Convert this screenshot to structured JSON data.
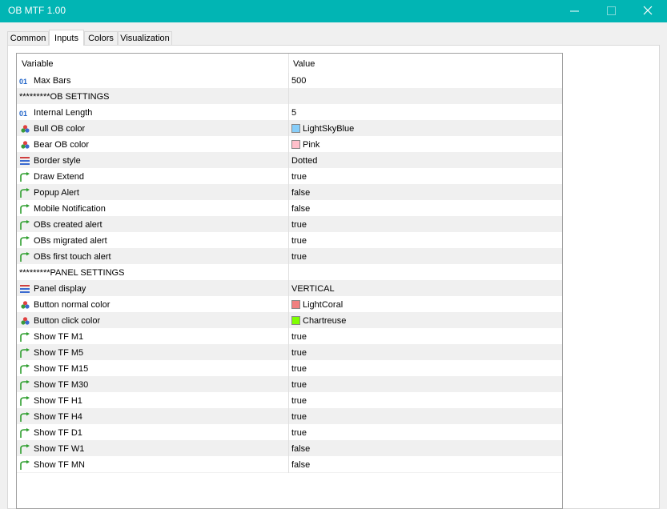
{
  "window": {
    "title": "OB MTF 1.00"
  },
  "tabs": [
    {
      "label": "Common",
      "active": false
    },
    {
      "label": "Inputs",
      "active": true
    },
    {
      "label": "Colors",
      "active": false
    },
    {
      "label": "Visualization",
      "active": false
    }
  ],
  "table": {
    "headers": {
      "variable": "Variable",
      "value": "Value"
    },
    "rows": [
      {
        "icon": "int-icon",
        "name": "Max Bars",
        "value": "500"
      },
      {
        "icon": "",
        "name": "*********OB SETTINGS",
        "value": ""
      },
      {
        "icon": "int-icon",
        "name": "Internal Length",
        "value": "5"
      },
      {
        "icon": "color-icon",
        "name": "Bull OB color",
        "value": "LightSkyBlue",
        "swatch": "#87cefa"
      },
      {
        "icon": "color-icon",
        "name": "Bear OB color",
        "value": "Pink",
        "swatch": "#ffc0cb"
      },
      {
        "icon": "enum-icon",
        "name": "Border style",
        "value": "Dotted"
      },
      {
        "icon": "bool-icon",
        "name": "Draw Extend",
        "value": "true"
      },
      {
        "icon": "bool-icon",
        "name": "Popup Alert",
        "value": "false"
      },
      {
        "icon": "bool-icon",
        "name": "Mobile Notification",
        "value": "false"
      },
      {
        "icon": "bool-icon",
        "name": "OBs created alert",
        "value": "true"
      },
      {
        "icon": "bool-icon",
        "name": "OBs migrated alert",
        "value": "true"
      },
      {
        "icon": "bool-icon",
        "name": "OBs first touch alert",
        "value": "true"
      },
      {
        "icon": "",
        "name": "*********PANEL SETTINGS",
        "value": ""
      },
      {
        "icon": "enum-icon",
        "name": "Panel display",
        "value": "VERTICAL"
      },
      {
        "icon": "color-icon",
        "name": "Button normal color",
        "value": "LightCoral",
        "swatch": "#f08080"
      },
      {
        "icon": "color-icon",
        "name": "Button click color",
        "value": "Chartreuse",
        "swatch": "#7fff00"
      },
      {
        "icon": "bool-icon",
        "name": "Show TF M1",
        "value": "true"
      },
      {
        "icon": "bool-icon",
        "name": "Show TF M5",
        "value": "true"
      },
      {
        "icon": "bool-icon",
        "name": "Show TF M15",
        "value": "true"
      },
      {
        "icon": "bool-icon",
        "name": "Show TF M30",
        "value": "true"
      },
      {
        "icon": "bool-icon",
        "name": "Show TF H1",
        "value": "true"
      },
      {
        "icon": "bool-icon",
        "name": "Show TF H4",
        "value": "true"
      },
      {
        "icon": "bool-icon",
        "name": "Show TF D1",
        "value": "true"
      },
      {
        "icon": "bool-icon",
        "name": "Show TF W1",
        "value": "false"
      },
      {
        "icon": "bool-icon",
        "name": "Show TF MN",
        "value": "false"
      }
    ]
  },
  "colors": {
    "titlebar": "#01b5b4",
    "bool_icon": "#2e9e2e",
    "int_icon": "#1f63c8"
  }
}
